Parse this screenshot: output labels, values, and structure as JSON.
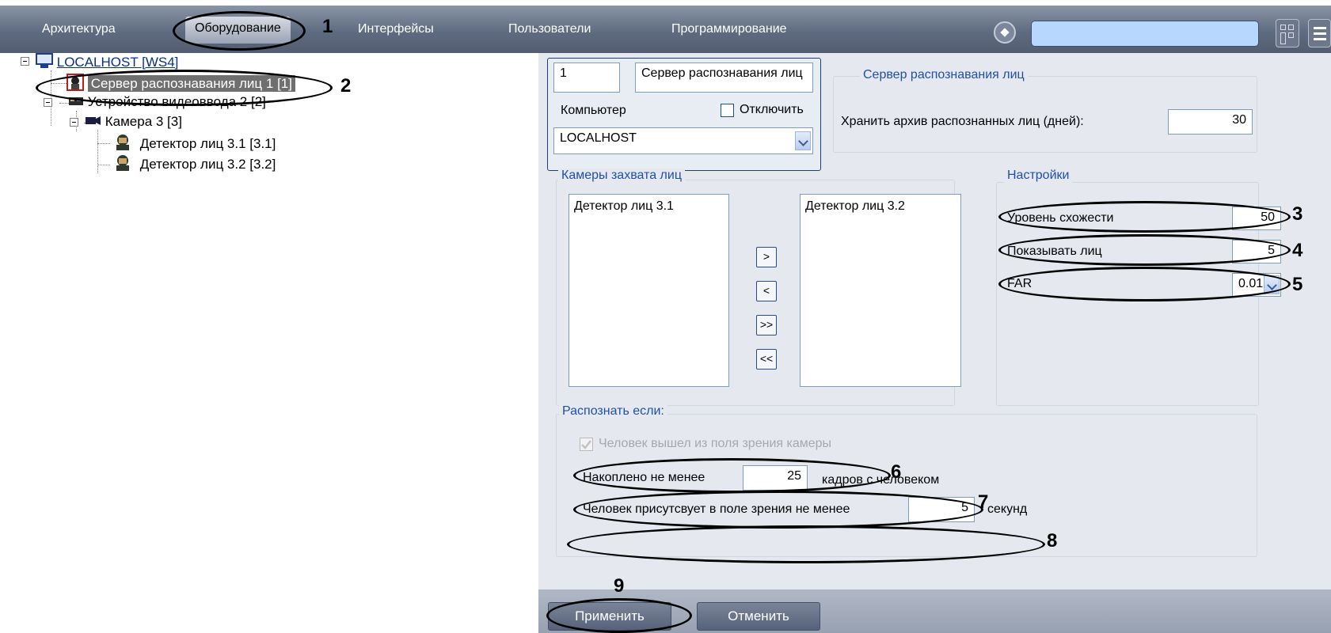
{
  "menu": {
    "architecture": "Архитектура",
    "hardware": "Оборудование",
    "interfaces": "Интерфейсы",
    "users": "Пользователи",
    "programming": "Программирование",
    "search_value": ""
  },
  "tree": {
    "root": "LOCALHOST [WS4]",
    "server": "Сервер распознавания лиц 1 [1]",
    "video_device": "Устройство видеоввода 2 [2]",
    "camera": "Камера 3 [3]",
    "detector1": "Детектор лиц 3.1 [3.1]",
    "detector2": "Детектор лиц 3.2 [3.2]"
  },
  "header": {
    "id": "1",
    "name": "Сервер распознавания лиц",
    "computer_label": "Компьютер",
    "disable_label": "Отключить",
    "disable_checked": false,
    "computer_value": "LOCALHOST"
  },
  "server_group": {
    "title": "Сервер распознавания лиц",
    "archive_label": "Хранить архив распознанных лиц (дней):",
    "archive_value": "30"
  },
  "cameras": {
    "title": "Камеры захвата лиц",
    "left_list": [
      "Детектор лиц 3.1"
    ],
    "right_list": [
      "Детектор лиц 3.2"
    ],
    "btn_add": ">",
    "btn_remove": "<",
    "btn_add_all": ">>",
    "btn_remove_all": "<<"
  },
  "settings": {
    "title": "Настройки",
    "similarity_label": "Уровень схожести",
    "similarity_value": "50",
    "show_faces_label": "Показывать лиц",
    "show_faces_value": "5",
    "far_label": "FAR",
    "far_value": "0.01"
  },
  "recognize": {
    "title": "Распознать если:",
    "left_view_label": "Человек вышел из поля зрения камеры",
    "left_view_checked": true,
    "accumulated_label": "Накоплено не менее",
    "accumulated_value": "25",
    "accumulated_unit": "кадров с человеком",
    "present_label": "Человек присутсвует в поле зрения не менее",
    "present_value": "5",
    "present_unit": "секунд"
  },
  "buttons": {
    "apply": "Применить",
    "cancel": "Отменить"
  },
  "annotations": [
    "1",
    "2",
    "3",
    "4",
    "5",
    "6",
    "7",
    "8",
    "9"
  ]
}
